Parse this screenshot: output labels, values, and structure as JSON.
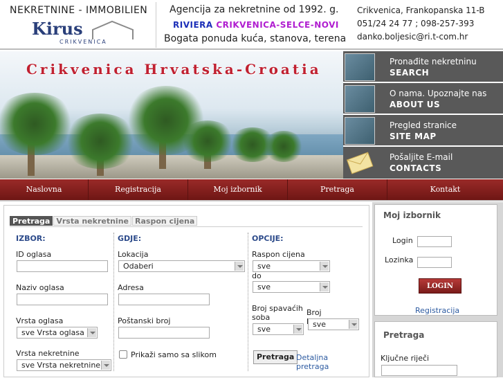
{
  "header": {
    "logo_top": "NEKRETNINE - IMMOBILIEN",
    "logo_name": "Kirus",
    "logo_sub": "CRIKVENICA",
    "tagline1": "Agencija za nekretnine od 1992. g.",
    "tagline2_riviera": "RIVIERA",
    "tagline2_places": "CRIKVENICA-SELCE-NOVI",
    "tagline3": "Bogata ponuda kuća, stanova, terena",
    "address": "Crikvenica, Frankopanska 11-B",
    "phones": "051/24 24 77 ; 098-257-393",
    "email": "danko.boljesic@ri.t-com.hr"
  },
  "banner": {
    "title": "Crikvenica Hrvatska-Croatia"
  },
  "side_menu": [
    {
      "top": "Pronađite nekretninu",
      "bottom": "SEARCH"
    },
    {
      "top": "O nama. Upoznajte nas",
      "bottom": "ABOUT US"
    },
    {
      "top": "Pregled stranice",
      "bottom": "SITE MAP"
    },
    {
      "top": "Pošaljite E-mail",
      "bottom": "CONTACTS"
    }
  ],
  "nav": [
    "Naslovna",
    "Registracija",
    "Moj izbornik",
    "Pretraga",
    "Kontakt"
  ],
  "tabs": [
    "Pretraga",
    "Vrsta nekretnine",
    "Raspon cijena"
  ],
  "search": {
    "col1_header": "IZBOR:",
    "col2_header": "GDJE:",
    "col3_header": "OPCIJE:",
    "id_label": "ID oglasa",
    "naziv_label": "Naziv oglasa",
    "vrsta_oglasa_label": "Vrsta oglasa",
    "vrsta_oglasa_value": "sve Vrsta oglasa",
    "vrsta_nekretnine_label": "Vrsta nekretnine",
    "vrsta_nekretnine_value": "sve Vrsta nekretnine",
    "lokacija_label": "Lokacija",
    "lokacija_value": "Odaberi",
    "adresa_label": "Adresa",
    "postanski_label": "Poštanski broj",
    "slike_label": "Prikaži samo sa slikom",
    "raspon_label": "Raspon cijena",
    "raspon_value": "sve",
    "do_label": "do",
    "do_value": "sve",
    "spavacih_label1": "Broj spavaćih",
    "spavacih_label2": "soba",
    "spavacih_value": "sve",
    "kupaonica_label": "Broj kupaonica",
    "kupaonica_value": "sve",
    "search_button": "Pretraga",
    "advanced_link": "Detaljna pretraga"
  },
  "login_box": {
    "title": "Moj izbornik",
    "login_label": "Login",
    "password_label": "Lozinka",
    "button": "LOGIN",
    "register_link": "Registracija"
  },
  "search_box": {
    "title": "Pretraga",
    "keywords_label": "Ključne riječi"
  }
}
